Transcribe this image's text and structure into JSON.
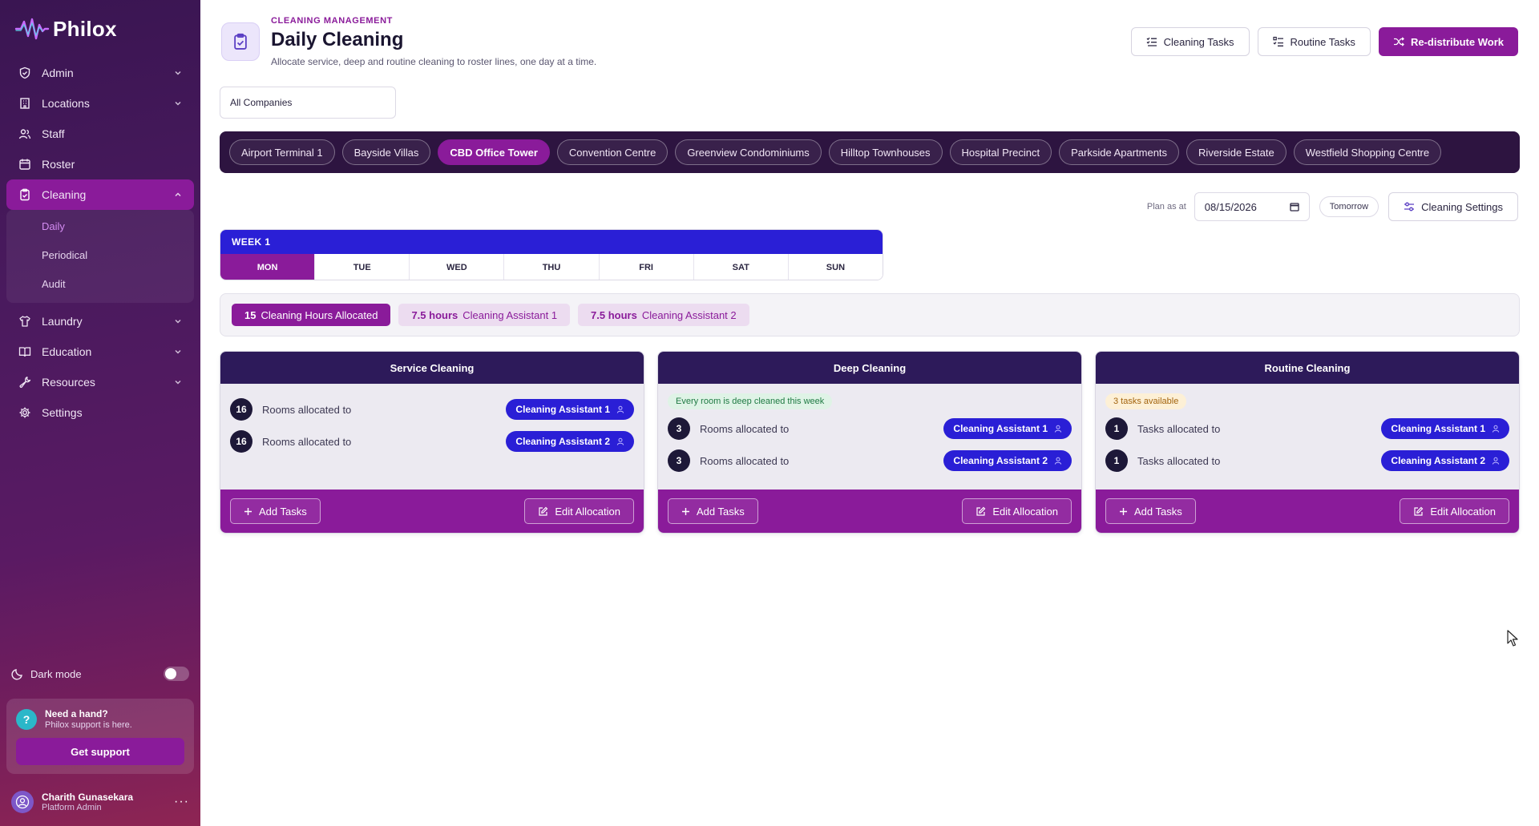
{
  "brand": {
    "name": "Philox"
  },
  "sidebar": {
    "items": [
      {
        "key": "admin",
        "label": "Admin",
        "icon": "shield-icon",
        "expandable": true
      },
      {
        "key": "locations",
        "label": "Locations",
        "icon": "building-icon",
        "expandable": true
      },
      {
        "key": "staff",
        "label": "Staff",
        "icon": "users-icon",
        "expandable": false
      },
      {
        "key": "roster",
        "label": "Roster",
        "icon": "calendar-icon",
        "expandable": false
      },
      {
        "key": "cleaning",
        "label": "Cleaning",
        "icon": "clipboard-check-icon",
        "expandable": true,
        "active": true
      },
      {
        "key": "laundry",
        "label": "Laundry",
        "icon": "shirt-icon",
        "expandable": true
      },
      {
        "key": "education",
        "label": "Education",
        "icon": "book-icon",
        "expandable": true
      },
      {
        "key": "resources",
        "label": "Resources",
        "icon": "wrench-icon",
        "expandable": true
      },
      {
        "key": "settings",
        "label": "Settings",
        "icon": "gear-icon",
        "expandable": false
      }
    ],
    "cleaning_sub": [
      "Daily",
      "Periodical",
      "Audit"
    ],
    "active_sub": "Daily",
    "dark_mode_label": "Dark mode",
    "help": {
      "title": "Need a hand?",
      "subtitle": "Philox support is here.",
      "button": "Get support"
    },
    "user": {
      "name": "Charith Gunasekara",
      "role": "Platform Admin"
    }
  },
  "header": {
    "eyebrow": "CLEANING MANAGEMENT",
    "title": "Daily Cleaning",
    "subtitle": "Allocate service, deep and routine cleaning to roster lines, one day at a time.",
    "buttons": {
      "cleaning_tasks": "Cleaning Tasks",
      "routine_tasks": "Routine Tasks",
      "redistribute": "Re-distribute Work"
    }
  },
  "company_select": {
    "value": "All Companies"
  },
  "sites": [
    "Airport Terminal 1",
    "Bayside Villas",
    "CBD Office Tower",
    "Convention Centre",
    "Greenview Condominiums",
    "Hilltop Townhouses",
    "Hospital Precinct",
    "Parkside Apartments",
    "Riverside Estate",
    "Westfield Shopping Centre"
  ],
  "active_site": "CBD Office Tower",
  "plan": {
    "label": "Plan as at",
    "date": "08/15/2026",
    "tomorrow": "Tomorrow",
    "settings": "Cleaning Settings"
  },
  "week": {
    "label": "WEEK 1",
    "days": [
      "MON",
      "TUE",
      "WED",
      "THU",
      "FRI",
      "SAT",
      "SUN"
    ],
    "active_day": "MON"
  },
  "hours": {
    "total": {
      "value": "15",
      "label": "Cleaning Hours Allocated"
    },
    "assistants": [
      {
        "value": "7.5 hours",
        "label": "Cleaning Assistant 1"
      },
      {
        "value": "7.5 hours",
        "label": "Cleaning Assistant 2"
      }
    ]
  },
  "cards": [
    {
      "title": "Service Cleaning",
      "note": "",
      "rows": [
        {
          "count": "16",
          "text": "Rooms allocated to",
          "assignee": "Cleaning Assistant 1"
        },
        {
          "count": "16",
          "text": "Rooms allocated to",
          "assignee": "Cleaning Assistant 2"
        }
      ],
      "add_label": "Add Tasks",
      "edit_label": "Edit Allocation"
    },
    {
      "title": "Deep Cleaning",
      "note": "Every room is deep cleaned this week",
      "note_style": "green",
      "rows": [
        {
          "count": "3",
          "text": "Rooms allocated to",
          "assignee": "Cleaning Assistant 1"
        },
        {
          "count": "3",
          "text": "Rooms allocated to",
          "assignee": "Cleaning Assistant 2"
        }
      ],
      "add_label": "Add Tasks",
      "edit_label": "Edit Allocation"
    },
    {
      "title": "Routine Cleaning",
      "note": "3 tasks available",
      "note_style": "amber",
      "rows": [
        {
          "count": "1",
          "text": "Tasks allocated to",
          "assignee": "Cleaning Assistant 1"
        },
        {
          "count": "1",
          "text": "Tasks allocated to",
          "assignee": "Cleaning Assistant 2"
        }
      ],
      "add_label": "Add Tasks",
      "edit_label": "Edit Allocation"
    }
  ],
  "colors": {
    "accent": "#8a1b9a",
    "blue": "#2a1fd6",
    "sidebar": "#3a1552",
    "card_head": "#2d1a5a"
  }
}
